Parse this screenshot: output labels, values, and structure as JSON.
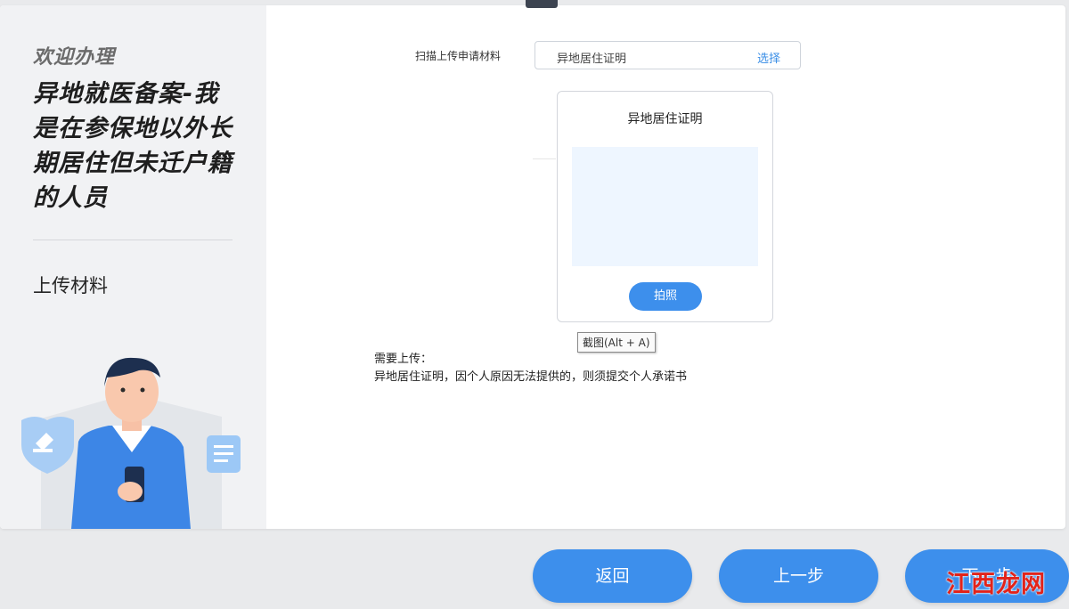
{
  "sidebar": {
    "welcome": "欢迎办理",
    "service_title": "异地就医备案-我是在参保地以外长期居住但未迁户籍的人员",
    "step": "上传材料"
  },
  "upload": {
    "label": "扫描上传申请材料",
    "file_name": "异地居住证明",
    "choose": "选择"
  },
  "document": {
    "title": "异地居住证明",
    "photo_button": "拍照"
  },
  "tooltip": "截图(Alt + A)",
  "requirements": {
    "heading": "需要上传：",
    "text": "异地居住证明，因个人原因无法提供的，则须提交个人承诺书"
  },
  "footer": {
    "back": "返回",
    "prev": "上一步",
    "next": "下一步"
  },
  "watermark": "江西龙网",
  "colors": {
    "accent": "#3d8fec",
    "link": "#3a8ee6",
    "preview_bg": "#eef6ff",
    "watermark": "#e2231a"
  },
  "icons": [
    "shield-gavel-icon",
    "document-icon"
  ]
}
